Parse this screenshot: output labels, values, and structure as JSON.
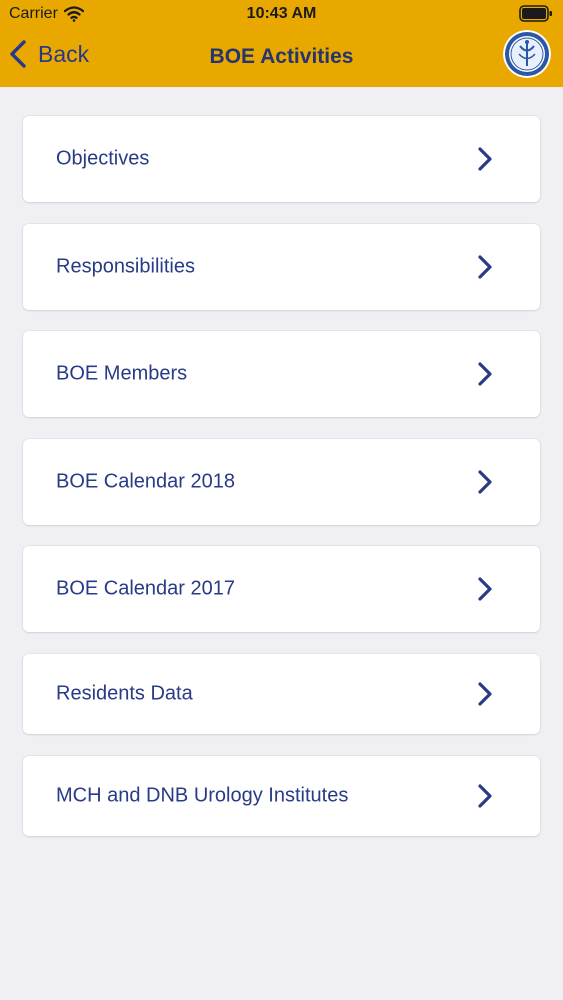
{
  "status_bar": {
    "carrier": "Carrier",
    "time": "10:43 AM"
  },
  "nav": {
    "back_label": "Back",
    "title": "BOE Activities"
  },
  "colors": {
    "header": "#e8a800",
    "text": "#283b86",
    "background": "#efeff4"
  },
  "menu": [
    {
      "label": "Objectives"
    },
    {
      "label": "Responsibilities"
    },
    {
      "label": "BOE Members"
    },
    {
      "label": "BOE Calendar 2018"
    },
    {
      "label": "BOE Calendar 2017"
    },
    {
      "label": "Residents Data"
    },
    {
      "label": "MCH and DNB Urology Institutes"
    }
  ]
}
